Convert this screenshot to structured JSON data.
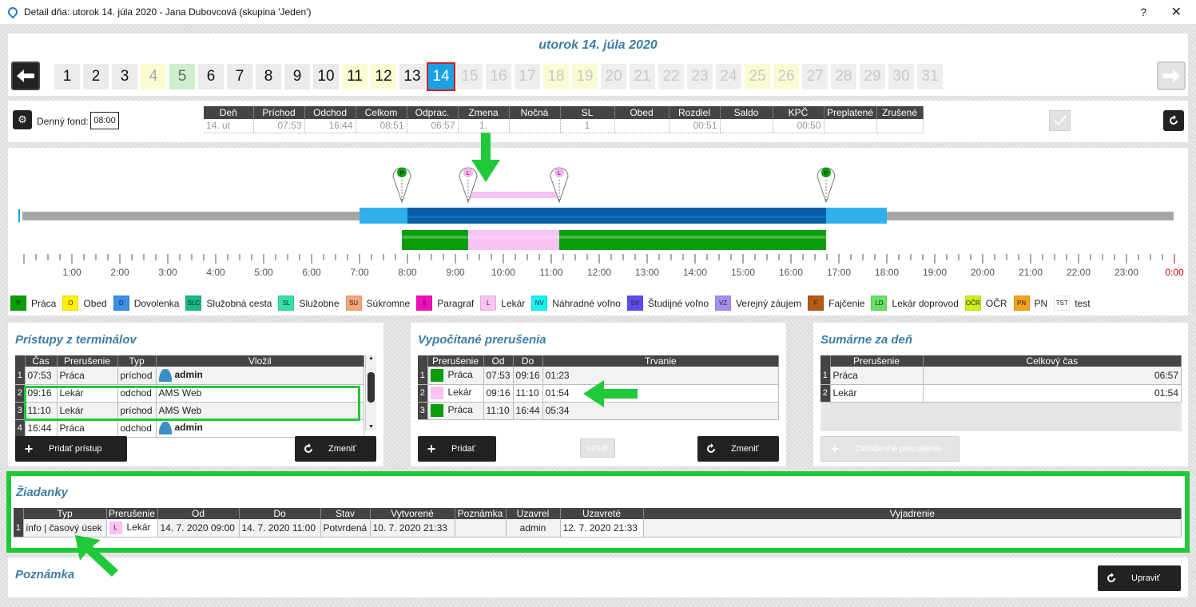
{
  "window": {
    "title": "Detail dňa: utorok 14. júla 2020 -  Jana Dubovcová  (skupina 'Jeden')",
    "help_label": "?",
    "close_label": "✕"
  },
  "day_header": {
    "title": "utorok 14. júla 2020",
    "prev_icon": "arrow-left-icon",
    "next_icon": "arrow-right-icon",
    "days": [
      {
        "label": "1",
        "style": "normal"
      },
      {
        "label": "2",
        "style": "normal"
      },
      {
        "label": "3",
        "style": "normal"
      },
      {
        "label": "4",
        "style": "yellow"
      },
      {
        "label": "5",
        "style": "green"
      },
      {
        "label": "6",
        "style": "normal"
      },
      {
        "label": "7",
        "style": "normal"
      },
      {
        "label": "8",
        "style": "normal"
      },
      {
        "label": "9",
        "style": "normal"
      },
      {
        "label": "10",
        "style": "normal"
      },
      {
        "label": "11",
        "style": "yellow active"
      },
      {
        "label": "12",
        "style": "yellow active"
      },
      {
        "label": "13",
        "style": "normal"
      },
      {
        "label": "14",
        "style": "selected"
      },
      {
        "label": "15",
        "style": "future"
      },
      {
        "label": "16",
        "style": "future"
      },
      {
        "label": "17",
        "style": "future"
      },
      {
        "label": "18",
        "style": "future yellow"
      },
      {
        "label": "19",
        "style": "future yellow"
      },
      {
        "label": "20",
        "style": "future"
      },
      {
        "label": "21",
        "style": "future"
      },
      {
        "label": "22",
        "style": "future"
      },
      {
        "label": "23",
        "style": "future"
      },
      {
        "label": "24",
        "style": "future"
      },
      {
        "label": "25",
        "style": "future yellow"
      },
      {
        "label": "26",
        "style": "future yellow"
      },
      {
        "label": "27",
        "style": "future"
      },
      {
        "label": "28",
        "style": "future"
      },
      {
        "label": "29",
        "style": "future"
      },
      {
        "label": "30",
        "style": "future"
      },
      {
        "label": "31",
        "style": "future"
      }
    ]
  },
  "summary": {
    "fund_label": "Denný fond:",
    "fund_value": "08:00",
    "headers": [
      "Deň",
      "Príchod",
      "Odchod",
      "Celkom",
      "Odprac.",
      "Zmena",
      "Nočná",
      "SL",
      "Obed",
      "Rozdiel",
      "Saldo",
      "KPČ",
      "Preplatené",
      "Zrušené"
    ],
    "values": [
      "14. ut",
      "07:53",
      "16:44",
      "08:51",
      "06:57",
      "1.",
      "",
      "1",
      "",
      "00:51",
      "",
      "00:50",
      "",
      ""
    ]
  },
  "timeline": {
    "hour_labels": [
      "1:00",
      "2:00",
      "3:00",
      "4:00",
      "5:00",
      "6:00",
      "7:00",
      "8:00",
      "9:00",
      "10:00",
      "11:00",
      "12:00",
      "13:00",
      "14:00",
      "15:00",
      "16:00",
      "17:00",
      "18:00",
      "19:00",
      "20:00",
      "21:00",
      "22:00",
      "23:00",
      "0:00"
    ],
    "markers": [
      {
        "time": "07:53",
        "label": "P",
        "color": "#0a9e0a"
      },
      {
        "time": "09:16",
        "label": "L",
        "color": "#f6b3f0"
      },
      {
        "time": "11:10",
        "label": "L",
        "color": "#f6b3f0"
      },
      {
        "time": "16:44",
        "label": "P",
        "color": "#0a9e0a"
      }
    ]
  },
  "legend": [
    {
      "code": "P",
      "label": "Práca",
      "color": "#0a9e0a"
    },
    {
      "code": "O",
      "label": "Obed",
      "color": "#fff200"
    },
    {
      "code": "D",
      "label": "Dovolenka",
      "color": "#3a8ee6"
    },
    {
      "code": "SLC",
      "label": "Služobná cesta",
      "color": "#18b98a"
    },
    {
      "code": "SL",
      "label": "Služobne",
      "color": "#36e0a6"
    },
    {
      "code": "SU",
      "label": "Súkromne",
      "color": "#f7a57a"
    },
    {
      "code": "§",
      "label": "Paragraf",
      "color": "#f010b8"
    },
    {
      "code": "L",
      "label": "Lekár",
      "color": "#f8c2f2"
    },
    {
      "code": "NV",
      "label": "Náhradné voľno",
      "color": "#14f2f2"
    },
    {
      "code": "SV",
      "label": "Študijné voľno",
      "color": "#5a4ef0"
    },
    {
      "code": "VZ",
      "label": "Verejný záujem",
      "color": "#a88ef2"
    },
    {
      "code": "F",
      "label": "Fajčenie",
      "color": "#b45a14"
    },
    {
      "code": "LD",
      "label": "Lekár doprovod",
      "color": "#66e066"
    },
    {
      "code": "OČR",
      "label": "OČR",
      "color": "#c8f21c"
    },
    {
      "code": "PN",
      "label": "PN",
      "color": "#f2a21c"
    },
    {
      "code": "TST",
      "label": "test",
      "color": "#ffffff"
    }
  ],
  "terminal_access": {
    "title": "Prístupy z terminálov",
    "headers": [
      "Čas",
      "Prerušenie",
      "Typ",
      "Vložil"
    ],
    "rows": [
      {
        "n": "1",
        "time": "07:53",
        "interruption": "Práca",
        "type": "príchod",
        "by": "admin"
      },
      {
        "n": "2",
        "time": "09:16",
        "interruption": "Lekár",
        "type": "odchod",
        "by": "AMS Web"
      },
      {
        "n": "3",
        "time": "11:10",
        "interruption": "Lekár",
        "type": "príchod",
        "by": "AMS Web"
      },
      {
        "n": "4",
        "time": "16:44",
        "interruption": "Práca",
        "type": "odchod",
        "by": "admin"
      }
    ],
    "add_button": "Pridať prístup",
    "change_button": "Zmeniť"
  },
  "computed_interruptions": {
    "title": "Vypočítané prerušenia",
    "headers": [
      "Prerušenie",
      "Od",
      "Do",
      "Trvanie"
    ],
    "rows": [
      {
        "n": "1",
        "name": "Práca",
        "color": "#0a9e0a",
        "from": "07:53",
        "to": "09:16",
        "duration": "01:23"
      },
      {
        "n": "2",
        "name": "Lekár",
        "color": "#f8c2f2",
        "from": "09:16",
        "to": "11:10",
        "duration": "01:54"
      },
      {
        "n": "3",
        "name": "Práca",
        "color": "#0a9e0a",
        "from": "11:10",
        "to": "16:44",
        "duration": "05:34"
      }
    ],
    "add_button": "Pridať",
    "approve_button": "uznať",
    "change_button": "Zmeniť"
  },
  "day_totals": {
    "title": "Sumárne za deň",
    "headers": [
      "Prerušenie",
      "Celkový čas"
    ],
    "rows": [
      {
        "n": "1",
        "name": "Práca",
        "total": "06:57"
      },
      {
        "n": "2",
        "name": "Lekár",
        "total": "01:54"
      }
    ],
    "fullday_button": "Celodenné prerušenie"
  },
  "requests": {
    "title": "Žiadanky",
    "headers": [
      "Typ",
      "Prerušenie",
      "Od",
      "Do",
      "Stav",
      "Vytvorené",
      "Poznámka",
      "Uzavrel",
      "Uzavreté",
      "Vyjadrenie"
    ],
    "rows": [
      {
        "n": "1",
        "type": "info | časový úsek",
        "code": "L",
        "interruption": "Lekár",
        "from": "14. 7. 2020 09:00",
        "to": "14. 7. 2020 11:00",
        "state": "Potvrdená",
        "created": "10. 7. 2020  21:33",
        "note": "",
        "closed_by": "admin",
        "closed_at": "12. 7. 2020  21:33",
        "statement": ""
      }
    ]
  },
  "note_section": {
    "title": "Poznámka",
    "edit_button": "Upraviť"
  }
}
